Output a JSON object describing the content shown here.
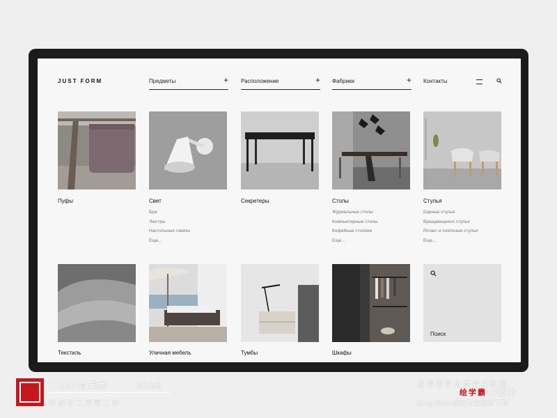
{
  "header": {
    "logo": "JUST FORM",
    "nav": [
      {
        "label": "Предметы",
        "plus": "+"
      },
      {
        "label": "Расположение",
        "plus": "+"
      },
      {
        "label": "Фабрики",
        "plus": "+"
      }
    ],
    "contact": "Контакты"
  },
  "cards": [
    {
      "title": "Пуфы",
      "items": []
    },
    {
      "title": "Свет",
      "items": [
        "Бра",
        "Люстры",
        "Настольные лампы",
        "Еще..."
      ]
    },
    {
      "title": "Секретеры",
      "items": []
    },
    {
      "title": "Столы",
      "items": [
        "Журнальные столы",
        "Компьютерные столы",
        "Кофейные столики",
        "Еще..."
      ]
    },
    {
      "title": "Стулья",
      "items": [
        "Барные стулья",
        "Вращающиеся стулья",
        "Ротанг и плетеные стулья",
        "Еще..."
      ]
    },
    {
      "title": "Текстиль",
      "items": []
    },
    {
      "title": "Уличная мебель",
      "items": []
    },
    {
      "title": "Тумбы",
      "items": []
    },
    {
      "title": "Шкафы",
      "items": []
    }
  ],
  "search_tile": {
    "label": "Поиск"
  },
  "watermark": {
    "title": "王氏教育集团",
    "slogan": "以人为本",
    "since": "始创于二零零二年",
    "right_top": "获得更多免费精品教程",
    "brand": "绘学霸",
    "ui": "UI设计",
    "right_bottom": "在AppStore或应用宝搜索下载"
  },
  "colors": {
    "device": "#1b1b1b",
    "screen": "#f7f7f7",
    "accent": "#c8161d"
  }
}
